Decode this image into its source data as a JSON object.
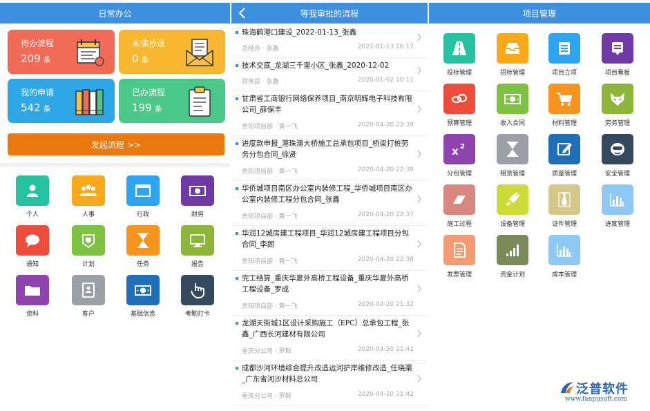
{
  "daily": {
    "title": "日常办公",
    "cards": [
      {
        "label": "待办流程",
        "count": "209",
        "unit": "条",
        "color": "#f26b57"
      },
      {
        "label": "未读抄送",
        "count": "0",
        "unit": "条",
        "color": "#f7b731"
      },
      {
        "label": "我的申请",
        "count": "542",
        "unit": "条",
        "color": "#2da7e6"
      },
      {
        "label": "已办流程",
        "count": "199",
        "unit": "条",
        "color": "#4cc98a"
      }
    ],
    "start_button": "发起流程 >>",
    "grid": [
      {
        "label": "个人",
        "color": "#26c2a1",
        "icon": "person-icon"
      },
      {
        "label": "人事",
        "color": "#f7a81b",
        "icon": "people-icon"
      },
      {
        "label": "行政",
        "color": "#2ea3f2",
        "icon": "window-icon"
      },
      {
        "label": "财务",
        "color": "#6f3aa6",
        "icon": "money-icon"
      },
      {
        "label": "通知",
        "color": "#ee4d3c",
        "icon": "chat-icon"
      },
      {
        "label": "计划",
        "color": "#7dc242",
        "icon": "badge-icon"
      },
      {
        "label": "任务",
        "color": "#f7941d",
        "icon": "hourglass-icon"
      },
      {
        "label": "报告",
        "color": "#8db53a",
        "icon": "monitor-icon"
      },
      {
        "label": "资料",
        "color": "#8e44ad",
        "icon": "folder-icon"
      },
      {
        "label": "客户",
        "color": "#9aa0a6",
        "icon": "contact-book-icon"
      },
      {
        "label": "基础信息",
        "color": "#1f6fb8",
        "icon": "banknote-icon"
      },
      {
        "label": "考勤打卡",
        "color": "#34495e",
        "icon": "hand-pointer-icon"
      }
    ]
  },
  "approvals": {
    "title": "等我审批的流程",
    "items": [
      {
        "title": "珠海鹤港口建设_2022-01-13_张鑫",
        "meta": "总经办 · 张鑫",
        "date": "2022-01-13 16:17",
        "lines": 1
      },
      {
        "title": "技术交底_龙湖三千里小区_张鑫_2020-12-02",
        "meta": "财务部 · 张鑫",
        "date": "2020-01-02 10:11",
        "lines": 1
      },
      {
        "title": "甘肃省工商银行网络保养项目_南京明辉电子科技有限公司_薛保丰",
        "meta": "贵阳项目部 · 黄一飞",
        "date": "2020-04-20 22:39",
        "lines": 2
      },
      {
        "title": "进度款申报_港珠澳大桥施工总承包项目_桥梁打桩劳务分包合同_徐贤",
        "meta": "贵阳项目部 · 黄一飞",
        "date": "2020-04-20 22:39",
        "lines": 2
      },
      {
        "title": "华侨城项目南区办公室内装修工程_华侨城项目南区办公室内装修工程分包合同_张鑫",
        "meta": "贵阳项目部 · 黄一飞",
        "date": "2020-04-20 22:37",
        "lines": 2
      },
      {
        "title": "华润12城房建工程项目_华润12城房建工程项目分包合同_李朗",
        "meta": "贵阳项目部 · 黄一飞",
        "date": "2020-04-20 22:38",
        "lines": 2
      },
      {
        "title": "完工结算_重庆华夏外高桥工程设备_重庆华夏外高桥工程设备_罗成",
        "meta": "贵阳项目部 · 黄一飞",
        "date": "2020-04-20 21:32",
        "lines": 2
      },
      {
        "title": "龙湖天街城1区设计采购施工（EPC）总承包工程_张鑫_广西长河建材有限公司",
        "meta": "重庆分公司 · 罗毅",
        "date": "2020-04-20 21:41",
        "lines": 2
      },
      {
        "title": "成都沙河环境综合提升改造运河护岸维修改造_任晓渠_广东省河沙材料总公司",
        "meta": "重庆分公司 · 罗毅",
        "date": "2020-04-20 21:42",
        "lines": 2
      }
    ]
  },
  "projects": {
    "title": "项目管理",
    "grid": [
      {
        "label": "投标管理",
        "color": "#26c2a1",
        "icon": "road-icon"
      },
      {
        "label": "招标管理",
        "color": "#f7a81b",
        "icon": "inbox-icon"
      },
      {
        "label": "项目立项",
        "color": "#2ea3f2",
        "icon": "list-icon"
      },
      {
        "label": "项目看板",
        "color": "#6f3aa6",
        "icon": "board-icon"
      },
      {
        "label": "预算管理",
        "color": "#ee4d3c",
        "icon": "cloud-link-icon"
      },
      {
        "label": "收入合同",
        "color": "#7dc242",
        "icon": "banknote-icon"
      },
      {
        "label": "材料管理",
        "color": "#f7941d",
        "icon": "cart-icon"
      },
      {
        "label": "劳务管理",
        "color": "#8db53a",
        "icon": "fox-icon"
      },
      {
        "label": "分包管理",
        "color": "#8e44ad",
        "icon": "superscript-icon"
      },
      {
        "label": "租赁管理",
        "color": "#9aa0a6",
        "icon": "hourglass-icon"
      },
      {
        "label": "质量管理",
        "color": "#1f6fb8",
        "icon": "edit-icon"
      },
      {
        "label": "安全管理",
        "color": "#34495e",
        "icon": "mask-icon"
      },
      {
        "label": "施工过程",
        "color": "#d98880",
        "icon": "eraser-icon"
      },
      {
        "label": "设备管理",
        "color": "#cddc39",
        "icon": "plug-icon"
      },
      {
        "label": "证件管理",
        "color": "#d4c98a",
        "icon": "tie-icon"
      },
      {
        "label": "进度管理",
        "color": "#8ec9f5",
        "icon": "bar-chart-icon"
      },
      {
        "label": "发票管理",
        "color": "#f39c73",
        "icon": "document-icon"
      },
      {
        "label": "资金计划",
        "color": "#7a8a5a",
        "icon": "signal-icon"
      },
      {
        "label": "成本管理",
        "color": "#8ec9f5",
        "icon": "bar-chart-icon"
      }
    ]
  },
  "logo": {
    "brand": "泛普软件",
    "url": "www.fanpusoft.com"
  }
}
